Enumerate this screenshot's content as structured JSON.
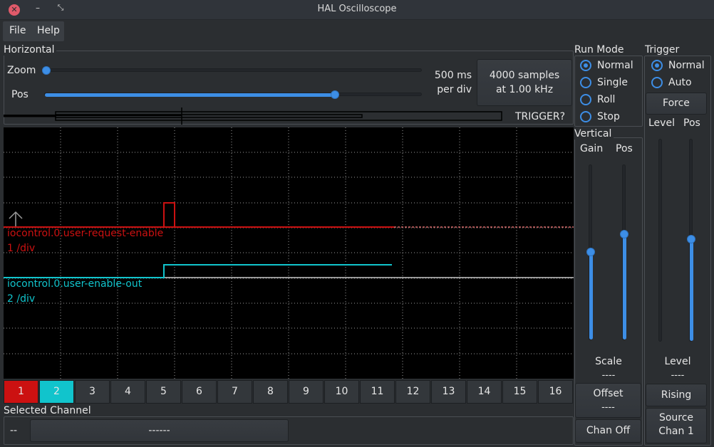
{
  "window": {
    "title": "HAL Oscilloscope"
  },
  "menu": {
    "file": "File",
    "help": "Help"
  },
  "horizontal": {
    "title": "Horizontal",
    "zoom_label": "Zoom",
    "pos_label": "Pos",
    "zoom_value": 0,
    "pos_value": 0.75,
    "time_per_div_line1": "500 ms",
    "time_per_div_line2": "per div",
    "samples_line1": "4000 samples",
    "samples_line2": "at 1.00 kHz",
    "trigger_status": "TRIGGER?"
  },
  "run_mode": {
    "title": "Run Mode",
    "options": [
      "Normal",
      "Single",
      "Roll",
      "Stop"
    ],
    "selected": "Normal"
  },
  "trigger": {
    "title": "Trigger",
    "options": [
      "Normal",
      "Auto"
    ],
    "selected": "Normal",
    "force_label": "Force",
    "level_label": "Level",
    "pos_label": "Pos",
    "level_caption": "Level",
    "level_value": "----",
    "rising_label": "Rising",
    "source_line1": "Source",
    "source_line2": "Chan  1",
    "level_slider": 0,
    "pos_slider": 0.55
  },
  "vertical": {
    "title": "Vertical",
    "gain_label": "Gain",
    "pos_label": "Pos",
    "scale_label": "Scale",
    "scale_value": "----",
    "offset_label": "Offset",
    "offset_value": "----",
    "chan_off_label": "Chan Off",
    "gain_slider": 0.5,
    "pos_slider": 0.6
  },
  "traces": [
    {
      "name": "iocontrol.0.user-request-enable",
      "scale": "1 /div",
      "color": "#cc1111"
    },
    {
      "name": "iocontrol.0.user-enable-out",
      "scale": "2 /div",
      "color": "#11c4cc"
    }
  ],
  "channels": {
    "labels": [
      "1",
      "2",
      "3",
      "4",
      "5",
      "6",
      "7",
      "8",
      "9",
      "10",
      "11",
      "12",
      "13",
      "14",
      "15",
      "16"
    ],
    "active_colors": {
      "1": "#cc1111",
      "2": "#11c4cc"
    }
  },
  "selected_channel": {
    "title": "Selected Channel",
    "number": "--",
    "signal": "------"
  },
  "colors": {
    "accent": "#3d8ee6",
    "background": "#2b2e31"
  }
}
